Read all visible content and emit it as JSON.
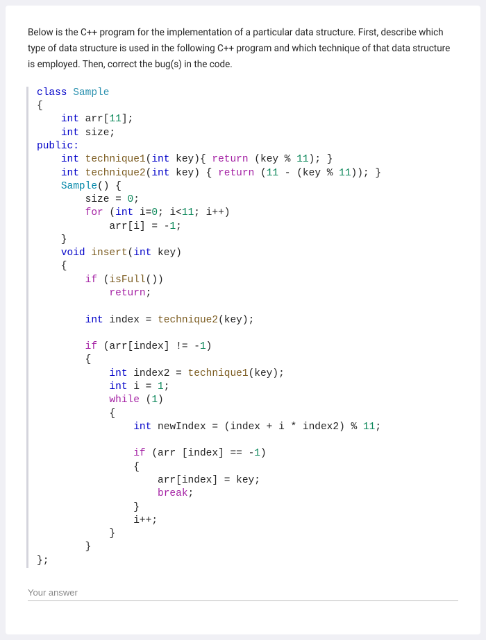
{
  "intro": "Below is the C++ program for the implementation of a particular data structure. First, describe which type of data structure is used in the following C++ program and which technique of that data structure is employed. Then, correct the bug(s) in the code.",
  "answer_placeholder": "Your answer",
  "code": {
    "l01a": "class",
    "l01b": " ",
    "l01c": "Sample",
    "l02": "{",
    "l03a": "    ",
    "l03b": "int",
    "l03c": " arr[",
    "l03d": "11",
    "l03e": "];",
    "l04a": "    ",
    "l04b": "int",
    "l04c": " size;",
    "l05": "public:",
    "l06a": "    ",
    "l06b": "int",
    "l06c": " ",
    "l06d": "technique1",
    "l06e": "(",
    "l06f": "int",
    "l06g": " key){ ",
    "l06h": "return",
    "l06i": " (key % ",
    "l06j": "11",
    "l06k": "); }",
    "l07a": "    ",
    "l07b": "int",
    "l07c": " ",
    "l07d": "technique2",
    "l07e": "(",
    "l07f": "int",
    "l07g": " key) { ",
    "l07h": "return",
    "l07i": " (",
    "l07j": "11",
    "l07k": " - (key % ",
    "l07l": "11",
    "l07m": ")); }",
    "l08a": "    ",
    "l08b": "Sample",
    "l08c": "() {",
    "l09a": "        size = ",
    "l09b": "0",
    "l09c": ";",
    "l10a": "        ",
    "l10b": "for",
    "l10c": " (",
    "l10d": "int",
    "l10e": " i=",
    "l10f": "0",
    "l10g": "; i<",
    "l10h": "11",
    "l10i": "; i++)",
    "l11a": "            arr[i] = -",
    "l11b": "1",
    "l11c": ";",
    "l12": "    }",
    "l13a": "    ",
    "l13b": "void",
    "l13c": " ",
    "l13d": "insert",
    "l13e": "(",
    "l13f": "int",
    "l13g": " key)",
    "l14": "    {",
    "l15a": "        ",
    "l15b": "if",
    "l15c": " (",
    "l15d": "isFull",
    "l15e": "())",
    "l16a": "            ",
    "l16b": "return",
    "l16c": ";",
    "l17": "",
    "l18a": "        ",
    "l18b": "int",
    "l18c": " index = ",
    "l18d": "technique2",
    "l18e": "(key);",
    "l19": "",
    "l20a": "        ",
    "l20b": "if",
    "l20c": " (arr[index] != -",
    "l20d": "1",
    "l20e": ")",
    "l21": "        {",
    "l22a": "            ",
    "l22b": "int",
    "l22c": " index2 = ",
    "l22d": "technique1",
    "l22e": "(key);",
    "l23a": "            ",
    "l23b": "int",
    "l23c": " i = ",
    "l23d": "1",
    "l23e": ";",
    "l24a": "            ",
    "l24b": "while",
    "l24c": " (",
    "l24d": "1",
    "l24e": ")",
    "l25": "            {",
    "l26a": "                ",
    "l26b": "int",
    "l26c": " newIndex = (index + i * index2) % ",
    "l26d": "11",
    "l26e": ";",
    "l27": "",
    "l28a": "                ",
    "l28b": "if",
    "l28c": " (arr [index] == -",
    "l28d": "1",
    "l28e": ")",
    "l29": "                {",
    "l30": "                    arr[index] = key;",
    "l31a": "                    ",
    "l31b": "break",
    "l31c": ";",
    "l32": "                }",
    "l33": "                i++;",
    "l34": "            }",
    "l35": "        }",
    "l36": "};"
  }
}
